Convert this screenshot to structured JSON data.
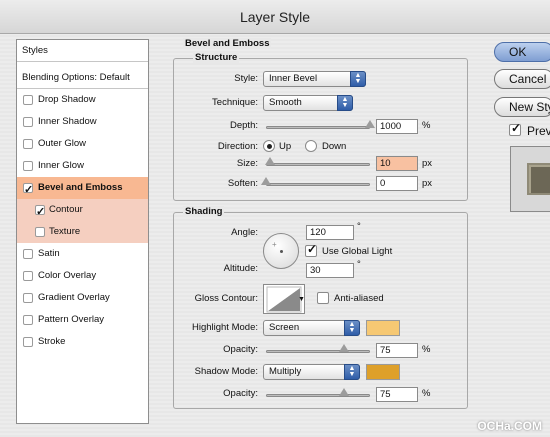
{
  "window": {
    "title": "Layer Style"
  },
  "styles_list": {
    "header": "Styles",
    "blending": "Blending Options: Default",
    "items": [
      {
        "label": "Drop Shadow",
        "checked": false
      },
      {
        "label": "Inner Shadow",
        "checked": false
      },
      {
        "label": "Outer Glow",
        "checked": false
      },
      {
        "label": "Inner Glow",
        "checked": false
      },
      {
        "label": "Bevel and Emboss",
        "checked": true,
        "selected": true
      },
      {
        "label": "Contour",
        "checked": true,
        "sub": true
      },
      {
        "label": "Texture",
        "checked": false,
        "sub": true
      },
      {
        "label": "Satin",
        "checked": false
      },
      {
        "label": "Color Overlay",
        "checked": false
      },
      {
        "label": "Gradient Overlay",
        "checked": false
      },
      {
        "label": "Pattern Overlay",
        "checked": false
      },
      {
        "label": "Stroke",
        "checked": false
      }
    ]
  },
  "panel": {
    "title": "Bevel and Emboss",
    "structure": {
      "title": "Structure",
      "style_label": "Style:",
      "style_value": "Inner Bevel",
      "technique_label": "Technique:",
      "technique_value": "Smooth",
      "depth_label": "Depth:",
      "depth_value": "1000",
      "depth_unit": "%",
      "depth_level": 1.0,
      "direction_label": "Direction:",
      "dir_up": "Up",
      "dir_down": "Down",
      "direction_selected": "Up",
      "size_label": "Size:",
      "size_value": "10",
      "size_unit": "px",
      "size_level": 0.04,
      "soften_label": "Soften:",
      "soften_value": "0",
      "soften_unit": "px",
      "soften_level": 0.0
    },
    "shading": {
      "title": "Shading",
      "angle_label": "Angle:",
      "angle_value": "120",
      "angle_unit": "°",
      "global_light_label": "Use Global Light",
      "global_light_checked": true,
      "altitude_label": "Altitude:",
      "altitude_value": "30",
      "altitude_unit": "°",
      "gloss_label": "Gloss Contour:",
      "anti_aliased_label": "Anti-aliased",
      "anti_aliased_checked": false,
      "highlight_label": "Highlight Mode:",
      "highlight_value": "Screen",
      "highlight_color": "#f6c873",
      "highlight_opacity_label": "Opacity:",
      "highlight_opacity": "75",
      "highlight_opacity_unit": "%",
      "highlight_level": 0.75,
      "shadow_label": "Shadow Mode:",
      "shadow_value": "Multiply",
      "shadow_color": "#dea02a",
      "shadow_opacity_label": "Opacity:",
      "shadow_opacity": "75",
      "shadow_opacity_unit": "%",
      "shadow_level": 0.75
    }
  },
  "buttons": {
    "ok": "OK",
    "cancel": "Cancel",
    "new_style": "New Style...",
    "preview": "Preview",
    "preview_checked": true
  },
  "watermark": "OCHa.COM"
}
